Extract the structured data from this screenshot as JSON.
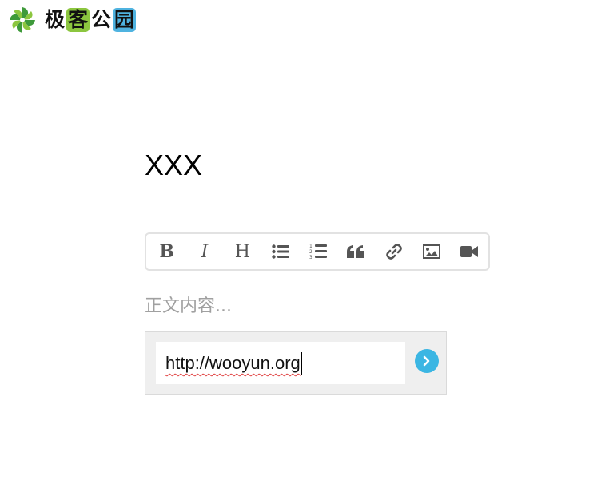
{
  "logo": {
    "chars": [
      "极",
      "客",
      "公",
      "园"
    ],
    "mark_color": "#4caf50",
    "accent_green": "#8cc63f",
    "accent_blue": "#4fb3e0"
  },
  "post": {
    "title": "XXX",
    "body_placeholder": "正文内容..."
  },
  "toolbar": {
    "bold_label": "B",
    "italic_label": "I",
    "heading_label": "H",
    "icons": [
      "bold-icon",
      "italic-icon",
      "heading-icon",
      "bullet-list-icon",
      "numbered-list-icon",
      "quote-icon",
      "link-icon",
      "image-icon",
      "video-icon"
    ]
  },
  "link_insert": {
    "url_value": "http://wooyun.org",
    "submit_icon": "chevron-right-icon",
    "submit_color": "#3bb6e3"
  }
}
